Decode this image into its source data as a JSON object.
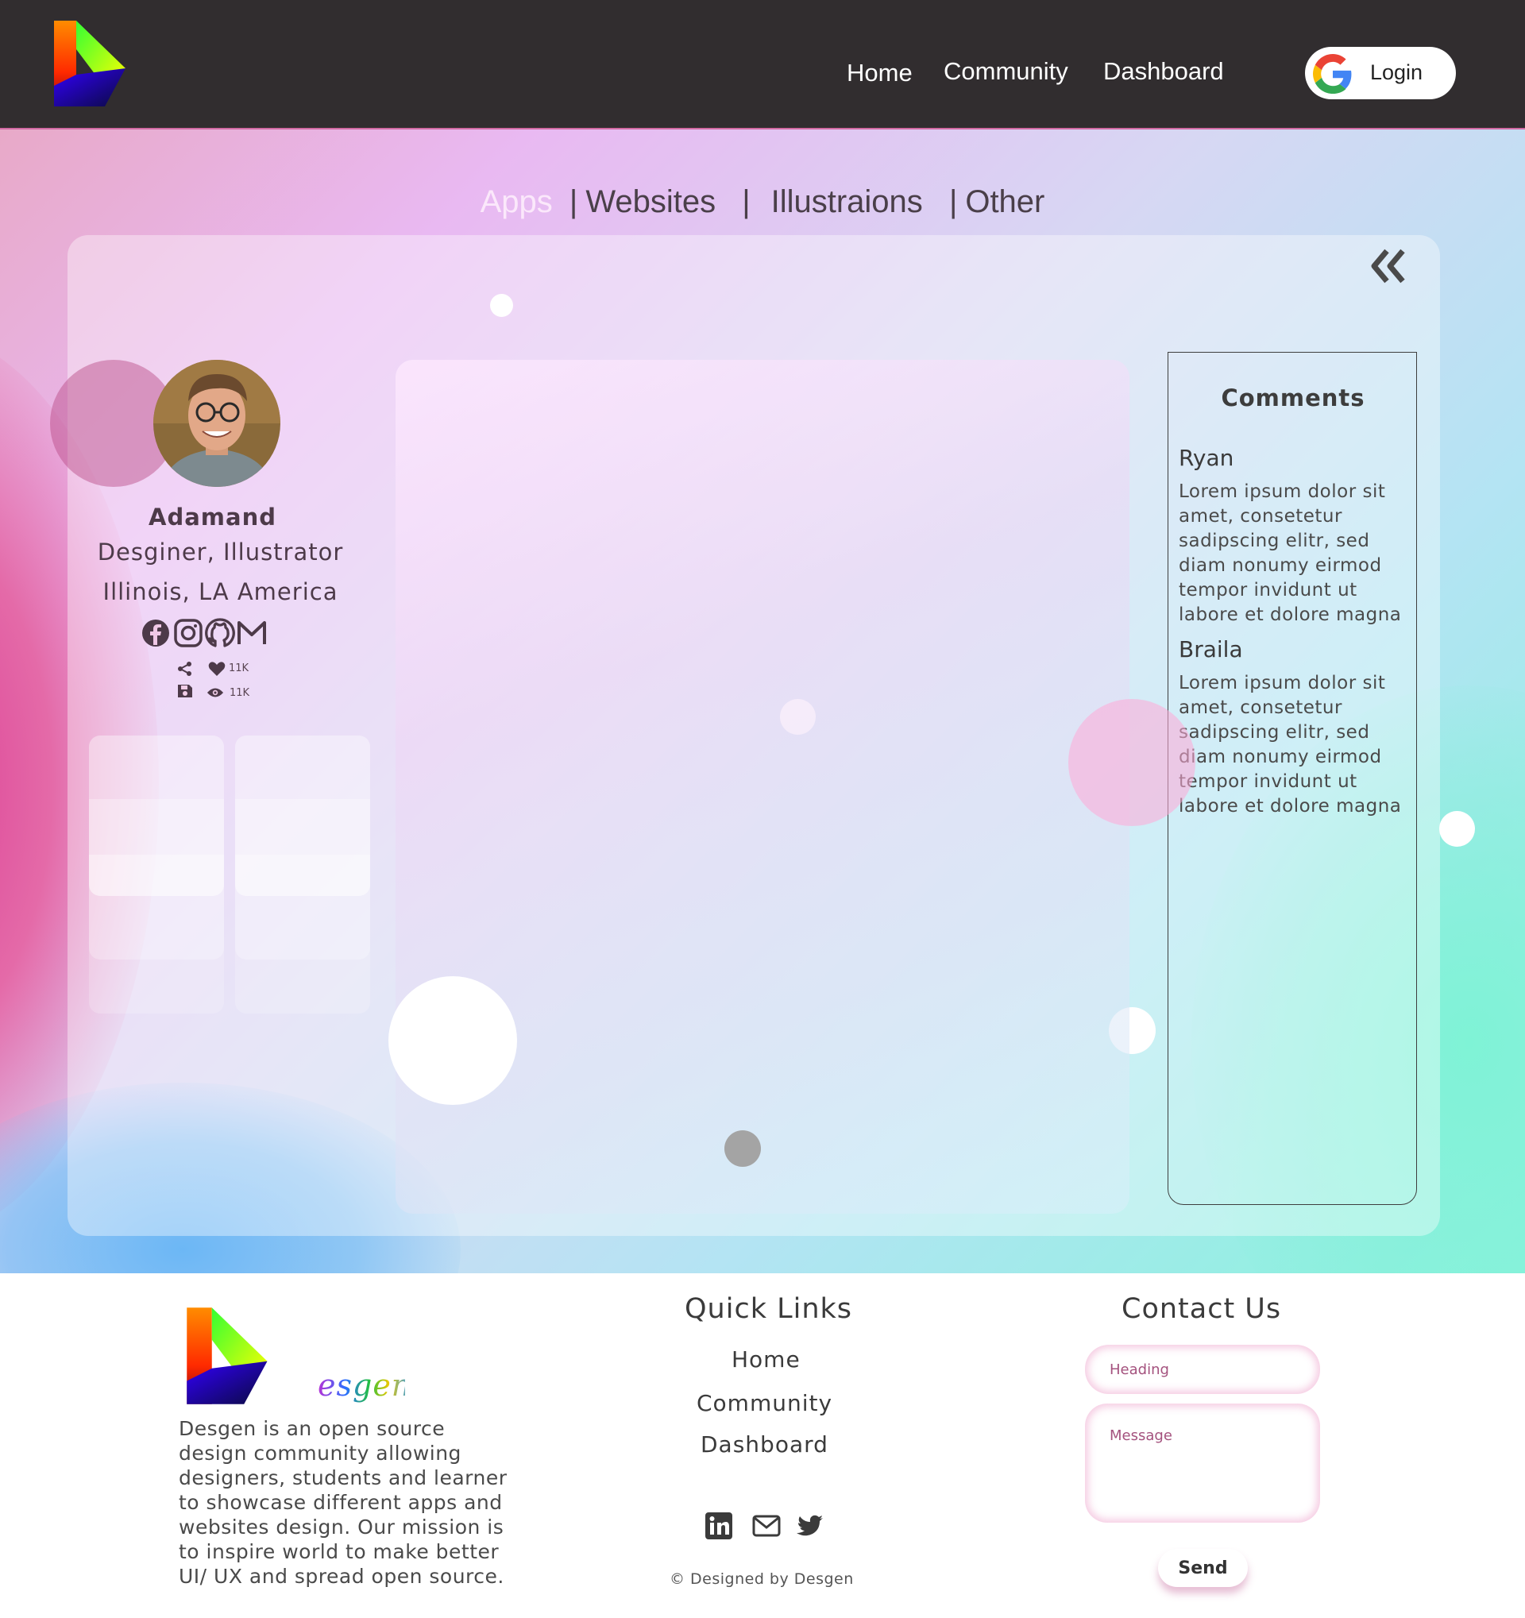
{
  "header": {
    "logo_icon": "desgen-logo-icon",
    "nav": [
      {
        "label": "Home"
      },
      {
        "label": "Community"
      },
      {
        "label": "Dashboard"
      }
    ],
    "login": {
      "label": "Login",
      "icon": "google-icon"
    }
  },
  "tabs": {
    "items": [
      {
        "label": "Apps",
        "active": true
      },
      {
        "label": "Websites",
        "active": false
      },
      {
        "label": "Illustraions",
        "active": false
      },
      {
        "label": "Other",
        "active": false
      }
    ],
    "separator": "|"
  },
  "profile": {
    "name": "Adamand",
    "role": "Desginer, Illustrator",
    "location": "Illinois, LA America",
    "socials": [
      "facebook-icon",
      "instagram-icon",
      "github-icon",
      "gmail-icon"
    ],
    "stats": {
      "likes": "11K",
      "views": "11K"
    }
  },
  "comments": {
    "title": "Comments",
    "items": [
      {
        "author": "Ryan",
        "text": "Lorem ipsum dolor sit amet, consetetur sadipscing elitr, sed diam nonumy eirmod tempor invidunt ut labore et dolore magna"
      },
      {
        "author": "Braila",
        "text": "Lorem ipsum dolor sit amet, consetetur sadipscing elitr, sed diam nonumy eirmod tempor invidunt ut labore et dolore magna"
      }
    ]
  },
  "footer": {
    "brand": "esgen",
    "description": "Desgen is an open source design community allowing designers, students and learner to showcase different apps and websites design. Our mission is to inspire world to make better UI/ UX and spread open source.",
    "quick_links": {
      "title": "Quick Links",
      "items": [
        {
          "label": "Home"
        },
        {
          "label": "Community"
        },
        {
          "label": "Dashboard"
        }
      ]
    },
    "socials": [
      "linkedin-icon",
      "mail-icon",
      "twitter-icon"
    ],
    "copyright": "© Designed by Desgen",
    "contact": {
      "title": "Contact Us",
      "heading_placeholder": "Heading",
      "message_placeholder": "Message",
      "send_label": "Send"
    }
  },
  "colors": {
    "header_bg": "#312d2f",
    "active_tab": "#fbe8fb",
    "text_dark": "#4a3f49",
    "input_accent": "#a4527e"
  }
}
